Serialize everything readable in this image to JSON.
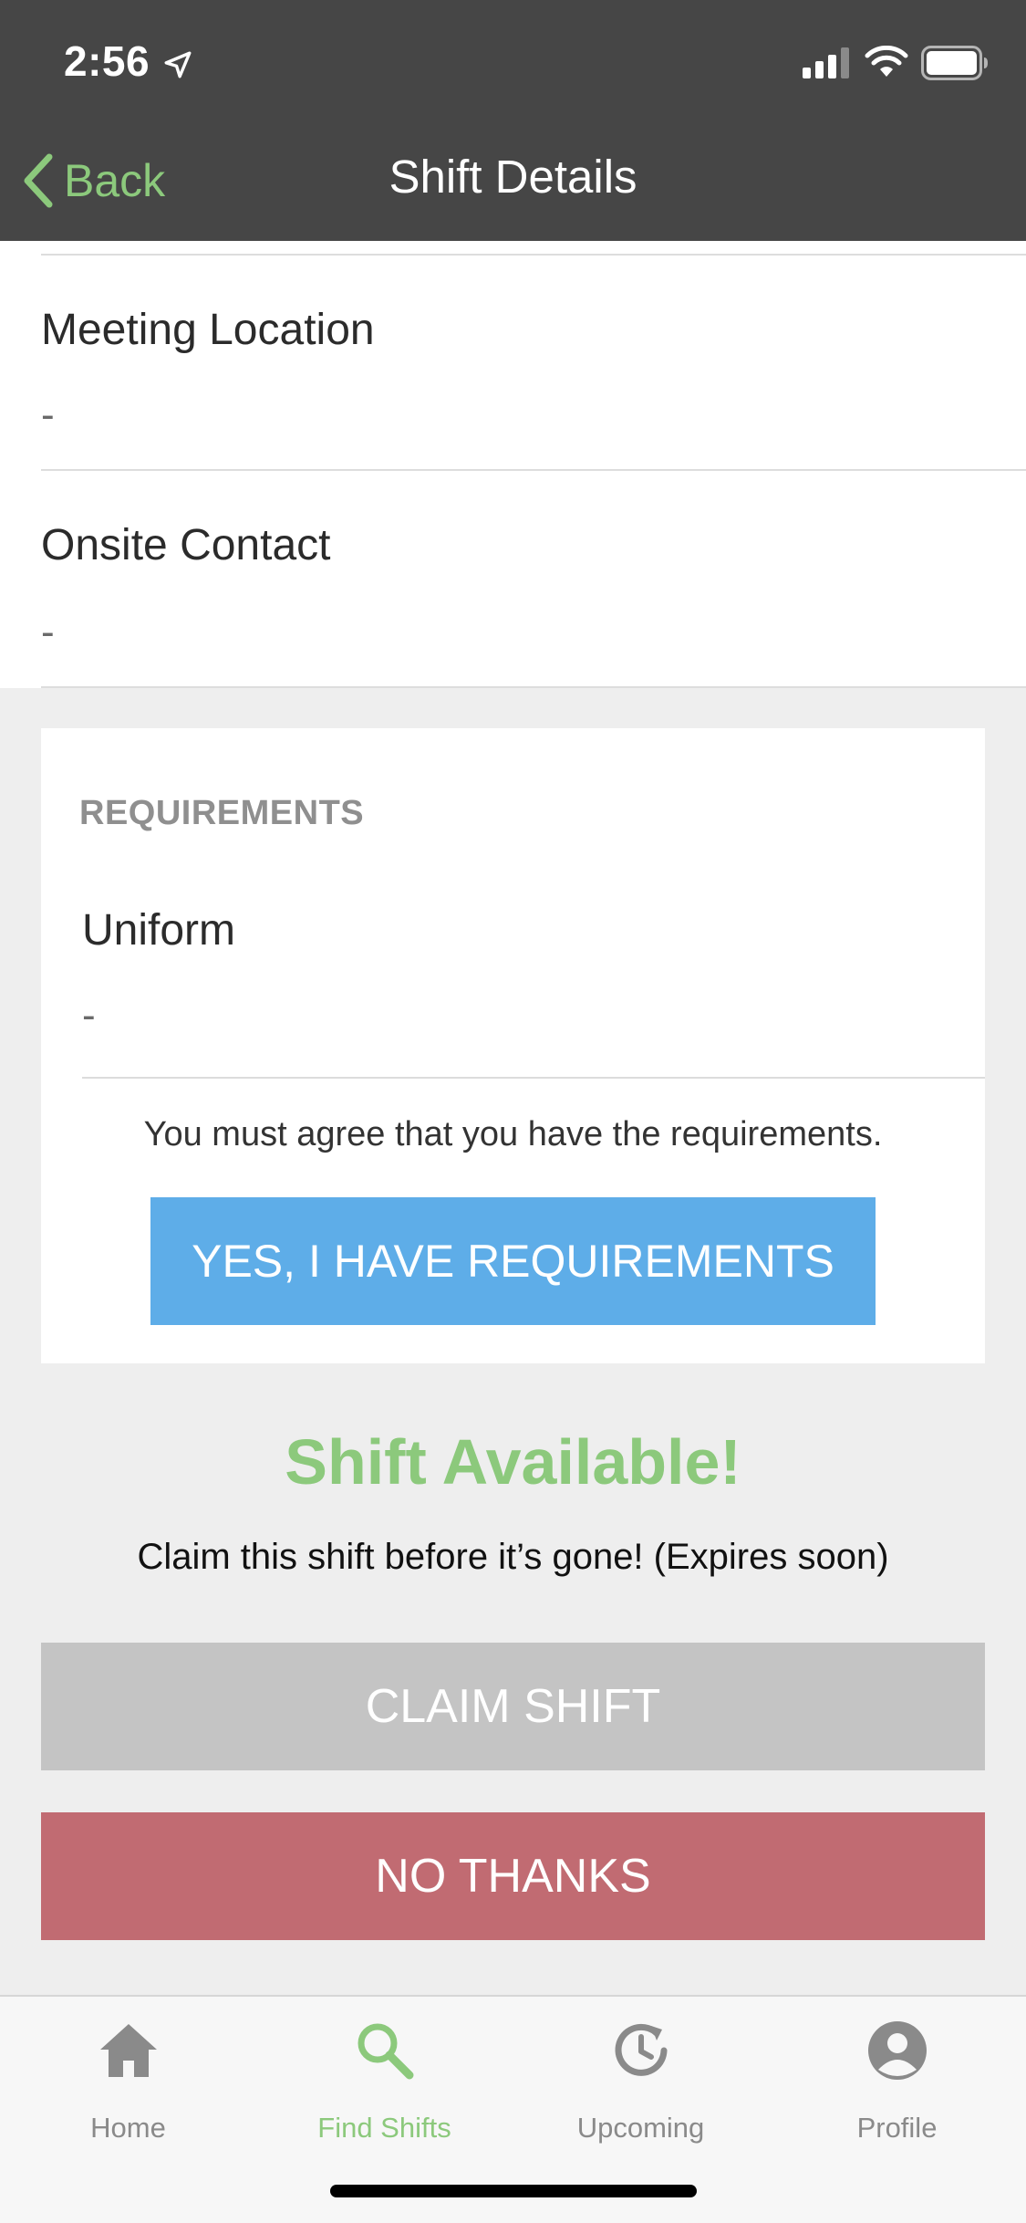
{
  "status_bar": {
    "time": "2:56"
  },
  "nav": {
    "back_label": "Back",
    "title": "Shift Details"
  },
  "details": [
    {
      "label": "Meeting Location",
      "value": "-"
    },
    {
      "label": "Onsite Contact",
      "value": "-"
    }
  ],
  "requirements": {
    "heading": "REQUIREMENTS",
    "items": [
      {
        "label": "Uniform",
        "value": "-"
      }
    ],
    "note": "You must agree that you have the requirements.",
    "confirm_label": "YES, I HAVE REQUIREMENTS"
  },
  "availability": {
    "title": "Shift Available!",
    "subtitle": "Claim this shift before it’s gone! (Expires soon)",
    "claim_label": "CLAIM SHIFT",
    "decline_label": "NO THANKS"
  },
  "tabs": [
    {
      "label": "Home",
      "icon": "home-icon",
      "active": false
    },
    {
      "label": "Find Shifts",
      "icon": "search-icon",
      "active": true
    },
    {
      "label": "Upcoming",
      "icon": "clock-history-icon",
      "active": false
    },
    {
      "label": "Profile",
      "icon": "profile-icon",
      "active": false
    }
  ],
  "colors": {
    "header_bg": "#464646",
    "accent_green": "#8cc97c",
    "confirm_blue": "#5eade8",
    "disabled_gray": "#c4c4c4",
    "decline_red": "#c16b72",
    "page_bg": "#eeeeee"
  }
}
